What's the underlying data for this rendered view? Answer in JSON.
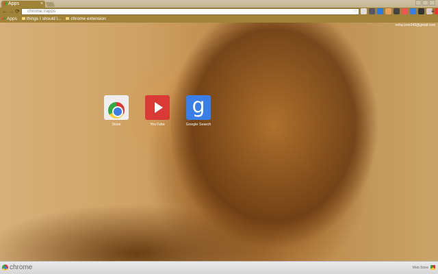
{
  "tab": {
    "title": "Apps",
    "close": "×"
  },
  "toolbar": {
    "back": "←",
    "forward": "→",
    "reload": "⟳",
    "url": "chrome://apps",
    "star": "☆",
    "menu": "≡"
  },
  "extensions": [
    {
      "color": "#ddd"
    },
    {
      "color": "#556"
    },
    {
      "color": "#2a7be0"
    },
    {
      "color": "#e8a060"
    },
    {
      "color": "#444"
    },
    {
      "color": "#e55"
    },
    {
      "color": "#3a7ee8"
    },
    {
      "color": "#333"
    },
    {
      "color": "#dcc"
    },
    {
      "color": "#e33"
    }
  ],
  "bookmarks": [
    {
      "label": "Apps"
    },
    {
      "label": "things I should l..."
    },
    {
      "label": "chrome extension"
    }
  ],
  "user": {
    "email": "neha.cree349@gmail.com"
  },
  "apps": [
    {
      "label": "Store"
    },
    {
      "label": "YouTube"
    },
    {
      "label": "Google Search",
      "glyph": "g"
    }
  ],
  "bottom": {
    "brand": "chrome",
    "webstore": "Web Store"
  }
}
